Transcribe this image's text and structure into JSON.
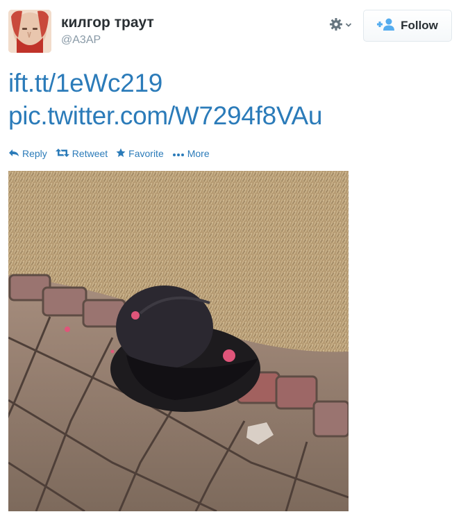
{
  "user": {
    "full_name": "килгор траут",
    "screen_name": "@A3AP"
  },
  "follow_button": {
    "label": "Follow"
  },
  "tweet": {
    "link1": "ift.tt/1eWc219",
    "link2": "pic.twitter.com/W7294f8VAu"
  },
  "actions": {
    "reply": "Reply",
    "retweet": "Retweet",
    "favorite": "Favorite",
    "more": "More"
  },
  "icons": {
    "gear": "gear-icon",
    "follow": "add-user-icon",
    "reply": "reply-arrow-icon",
    "retweet": "retweet-icon",
    "favorite": "star-icon",
    "more": "ellipsis-icon"
  },
  "colors": {
    "link": "#2b7bb9",
    "name": "#292f33",
    "handle": "#8899a6",
    "follow_icon": "#55acee"
  }
}
